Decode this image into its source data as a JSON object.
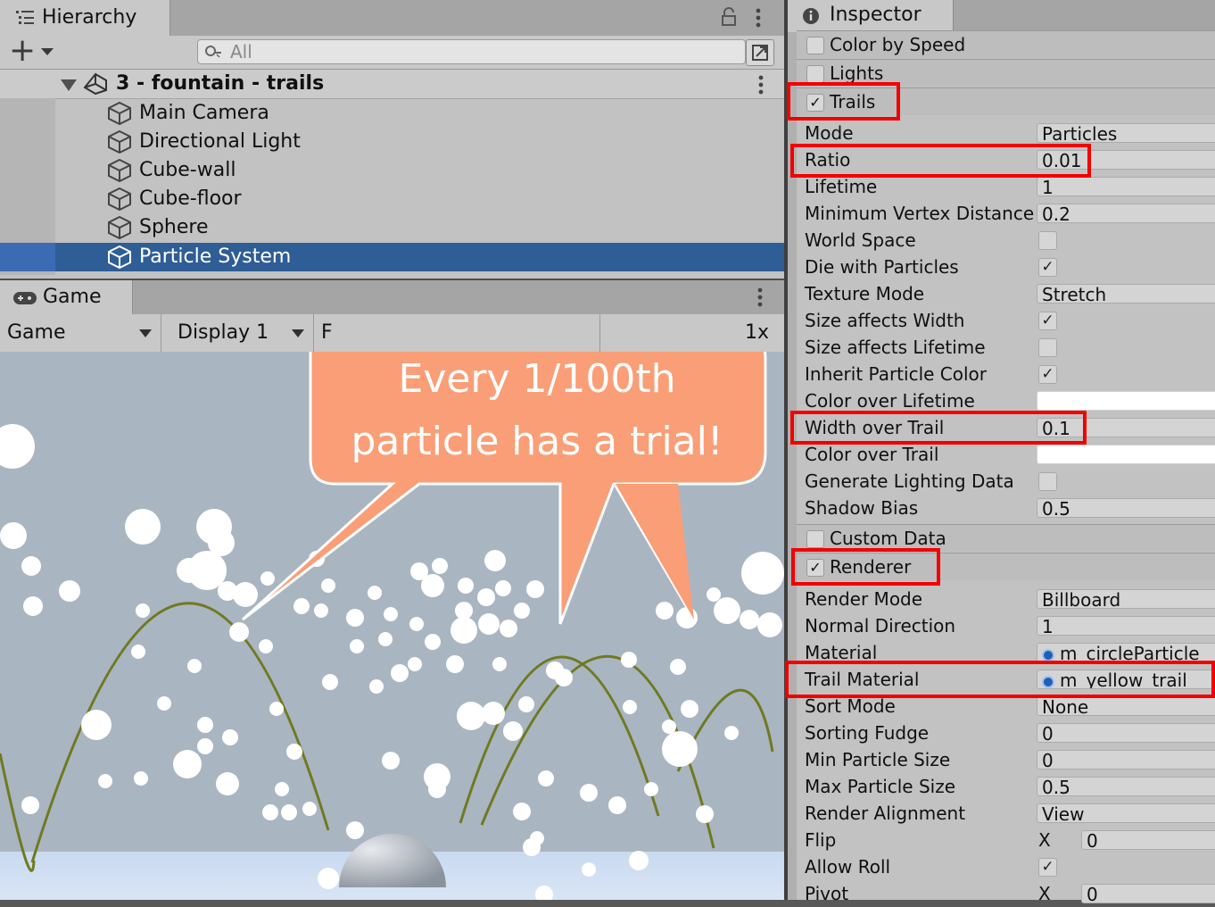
{
  "hierarchy": {
    "tab_title": "Hierarchy",
    "add_label": "+",
    "search_placeholder": "All",
    "scene_name": "3 - fountain - trails",
    "items": [
      {
        "label": "Main Camera"
      },
      {
        "label": "Directional Light"
      },
      {
        "label": "Cube-wall"
      },
      {
        "label": "Cube-floor"
      },
      {
        "label": "Sphere"
      },
      {
        "label": "Particle System",
        "selected": true
      }
    ]
  },
  "game": {
    "tab_title": "Game",
    "view_dropdown": "Game",
    "display_dropdown": "Display 1",
    "hidden_dropdown_glyph": "F",
    "scale_suffix": "1x",
    "callout_line1": "Every 1/100th",
    "callout_line2": "particle has a trial!",
    "callout_color": "#f99e76",
    "trail_color": "#6f7a20"
  },
  "inspector": {
    "tab_title": "Inspector",
    "modules": {
      "color_by_speed": "Color by Speed",
      "lights": "Lights",
      "trails": "Trails",
      "custom_data": "Custom Data",
      "renderer": "Renderer"
    },
    "trails_props": [
      {
        "label": "Mode",
        "value": "Particles"
      },
      {
        "label": "Ratio",
        "value": "0.01"
      },
      {
        "label": "Lifetime",
        "value": "1"
      },
      {
        "label": "Minimum Vertex Distance",
        "value": "0.2"
      },
      {
        "label": "World Space",
        "checked": false
      },
      {
        "label": "Die with Particles",
        "checked": true
      },
      {
        "label": "Texture Mode",
        "value": "Stretch"
      },
      {
        "label": "Size affects Width",
        "checked": true
      },
      {
        "label": "Size affects Lifetime",
        "checked": false
      },
      {
        "label": "Inherit Particle Color",
        "checked": true
      },
      {
        "label": "Color over Lifetime",
        "color": "#ffffff"
      },
      {
        "label": "Width over Trail",
        "value": "0.1"
      },
      {
        "label": "Color over Trail",
        "color": "#ffffff"
      },
      {
        "label": "Generate Lighting Data",
        "checked": false
      },
      {
        "label": "Shadow Bias",
        "value": "0.5"
      }
    ],
    "renderer_props": [
      {
        "label": "Render Mode",
        "value": "Billboard"
      },
      {
        "label": "Normal Direction",
        "value": "1"
      },
      {
        "label": "Material",
        "value": "m_circleParticle"
      },
      {
        "label": "Trail Material",
        "value": "m_yellow_trail"
      },
      {
        "label": "Sort Mode",
        "value": "None"
      },
      {
        "label": "Sorting Fudge",
        "value": "0"
      },
      {
        "label": "Min Particle Size",
        "value": "0"
      },
      {
        "label": "Max Particle Size",
        "value": "0.5"
      },
      {
        "label": "Render Alignment",
        "value": "View"
      },
      {
        "label": "Flip",
        "axis": "X",
        "value": "0"
      },
      {
        "label": "Allow Roll",
        "checked": true
      },
      {
        "label": "Pivot",
        "axis": "X",
        "value": "0"
      }
    ],
    "highlight_color": "#f20000"
  }
}
